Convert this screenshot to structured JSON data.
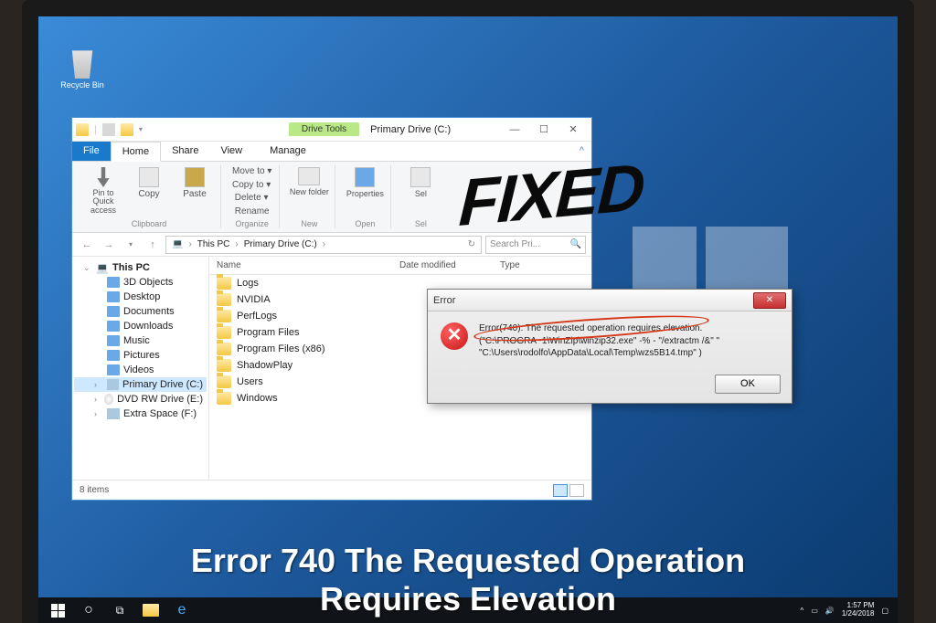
{
  "desktop": {
    "recycle_bin": "Recycle Bin"
  },
  "explorer": {
    "title": "Primary Drive (C:)",
    "drive_tools": "Drive Tools",
    "tabs": {
      "file": "File",
      "home": "Home",
      "share": "Share",
      "view": "View",
      "manage": "Manage"
    },
    "ribbon": {
      "pin": "Pin to Quick access",
      "copy": "Copy",
      "paste": "Paste",
      "clipboard": "Clipboard",
      "move_to": "Move to ▾",
      "copy_to": "Copy to ▾",
      "delete": "Delete ▾",
      "rename": "Rename",
      "organize": "Organize",
      "new_folder": "New folder",
      "new": "New",
      "properties": "Properties",
      "open": "Open",
      "select": "Sel",
      "select_grp": "Sel"
    },
    "breadcrumb": [
      "This PC",
      "Primary Drive (C:)"
    ],
    "search_placeholder": "Search Pri...",
    "tree": {
      "root": "This PC",
      "items": [
        {
          "label": "3D Objects"
        },
        {
          "label": "Desktop"
        },
        {
          "label": "Documents"
        },
        {
          "label": "Downloads"
        },
        {
          "label": "Music"
        },
        {
          "label": "Pictures"
        },
        {
          "label": "Videos"
        },
        {
          "label": "Primary Drive (C:)"
        },
        {
          "label": "DVD RW Drive (E:)"
        },
        {
          "label": "Extra Space (F:)"
        }
      ]
    },
    "columns": {
      "name": "Name",
      "date": "Date modified",
      "type": "Type"
    },
    "folders": [
      "Logs",
      "NVIDIA",
      "PerfLogs",
      "Program Files",
      "Program Files (x86)",
      "ShadowPlay",
      "Users",
      "Windows"
    ],
    "status": "8 items"
  },
  "error": {
    "title": "Error",
    "main": "Error(740): The requested operation requires elevation.",
    "detail1": "(\"C:\\PROGRA~1\\WinZip\\winzip32.exe\" -% - \"/extractm /&\" \"",
    "detail2": "\"C:\\Users\\rodolfo\\AppData\\Local\\Temp\\wzs5B14.tmp\" )",
    "ok": "OK"
  },
  "tray": {
    "time": "1:57 PM",
    "date": "1/24/2018"
  },
  "overlay": {
    "fixed": "FIXED",
    "caption1": "Error 740 The Requested Operation",
    "caption2": "Requires Elevation"
  }
}
